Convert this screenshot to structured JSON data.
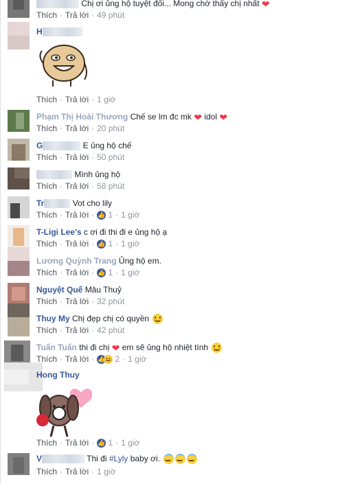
{
  "actions": {
    "like": "Thích",
    "reply": "Trả lời"
  },
  "comments": [
    {
      "text": "Chị ơi ủng hộ tuyệt đối... Mong chờ thấy chị nhất",
      "time": "49 phút"
    },
    {
      "name": "H",
      "time": "1 giờ",
      "sticker": "smiling-bear-sticker"
    },
    {
      "name": "Phạm Thị Hoài Thương",
      "text": "Chế se lm đc mk",
      "text2": "idol",
      "time": "20 phút"
    },
    {
      "name": "G",
      "text": "E ủng hộ chế",
      "time": "50 phút"
    },
    {
      "name": "",
      "text": "Mình ủng hộ",
      "time": "58 phút"
    },
    {
      "name": "Tr",
      "text": "Vot cho lily",
      "time": "1 giờ",
      "reactions": "1"
    },
    {
      "name": "T-Ligi Lee's",
      "text": "c ơi đi thi đi e ủng hộ ạ",
      "time": "1 giờ",
      "reactions": "1"
    },
    {
      "name": "Lương Quỳnh Trang",
      "text": "Ủng hộ em.",
      "time": "1 giờ",
      "reactions": "1"
    },
    {
      "name": "Nguyệt Quế",
      "text": "Mâu Thuỷ",
      "time": "32 phút"
    },
    {
      "name": "Thuy My",
      "text": "Chị đẹp chị có quyền",
      "time": "42 phút"
    },
    {
      "name": "Tuấn Tuấn",
      "text": "thi đi chị",
      "text2": "em sẽ ủng hộ nhiệt tình",
      "time": "1 giờ",
      "reactions": "2"
    },
    {
      "name": "Hong Thuy",
      "time": "1 giờ",
      "reactions": "1",
      "sticker": "puppy-heart-sticker"
    },
    {
      "name": "V",
      "text": "Thi đi",
      "tag": "#Lyly",
      "text2": "baby ơi.",
      "time": "1 giờ"
    }
  ],
  "colors": {
    "name": "#365899",
    "heart": "#f0374b",
    "like": "#3b5998"
  }
}
